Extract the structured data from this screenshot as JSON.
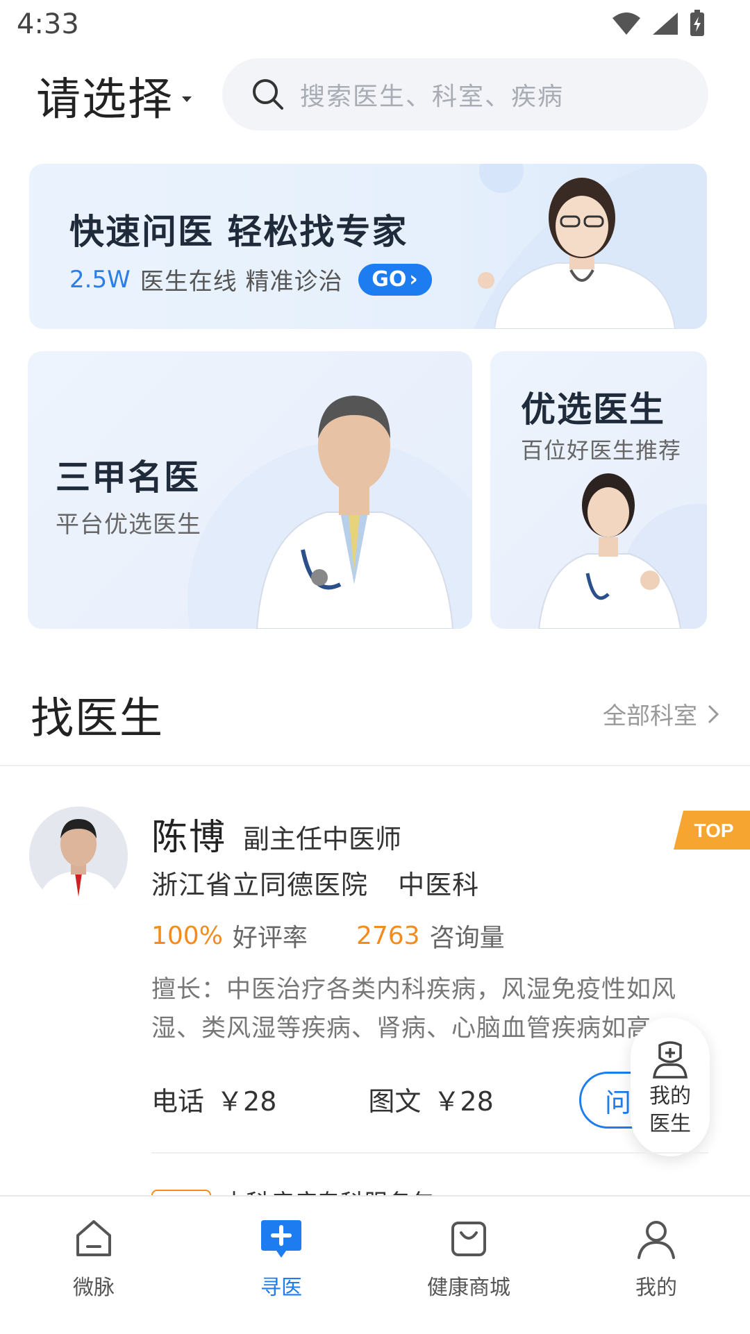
{
  "status_bar": {
    "time": "4:33"
  },
  "header": {
    "location_label": "请选择",
    "search_placeholder": "搜索医生、科室、疾病"
  },
  "banner": {
    "title": "快速问医 轻松找专家",
    "count": "2.5W",
    "subtitle": "医生在线 精准诊治",
    "go_label": "GO"
  },
  "cards": [
    {
      "title": "三甲名医",
      "subtitle": "平台优选医生"
    },
    {
      "title": "优选医生",
      "subtitle": "百位好医生推荐"
    }
  ],
  "section": {
    "title": "找医生",
    "link": "全部科室"
  },
  "doctor": {
    "name": "陈博",
    "title": "副主任中医师",
    "badge": "TOP",
    "hospital": "浙江省立同德医院",
    "department": "中医科",
    "rating_value": "100%",
    "rating_label": "好评率",
    "consult_value": "2763",
    "consult_label": "咨询量",
    "description": "擅长：中医治疗各类内科疾病，风湿免疫性如风湿、类风湿等疾病、肾病、心脑血管疾病如高...",
    "phone_label": "电话",
    "phone_price": "￥28",
    "text_label": "图文",
    "text_price": "￥28",
    "consult_button": "问"
  },
  "float_button": {
    "label": "我的医生"
  },
  "next_item": {
    "text": "内科疾病专科服务包"
  },
  "bottom_nav": [
    {
      "label": "微脉",
      "icon": "home-icon",
      "active": false
    },
    {
      "label": "寻医",
      "icon": "find-doctor-icon",
      "active": true
    },
    {
      "label": "健康商城",
      "icon": "shopping-bag-icon",
      "active": false
    },
    {
      "label": "我的",
      "icon": "user-icon",
      "active": false
    }
  ],
  "colors": {
    "primary": "#1c7cf0",
    "accent": "#f38b1e"
  }
}
